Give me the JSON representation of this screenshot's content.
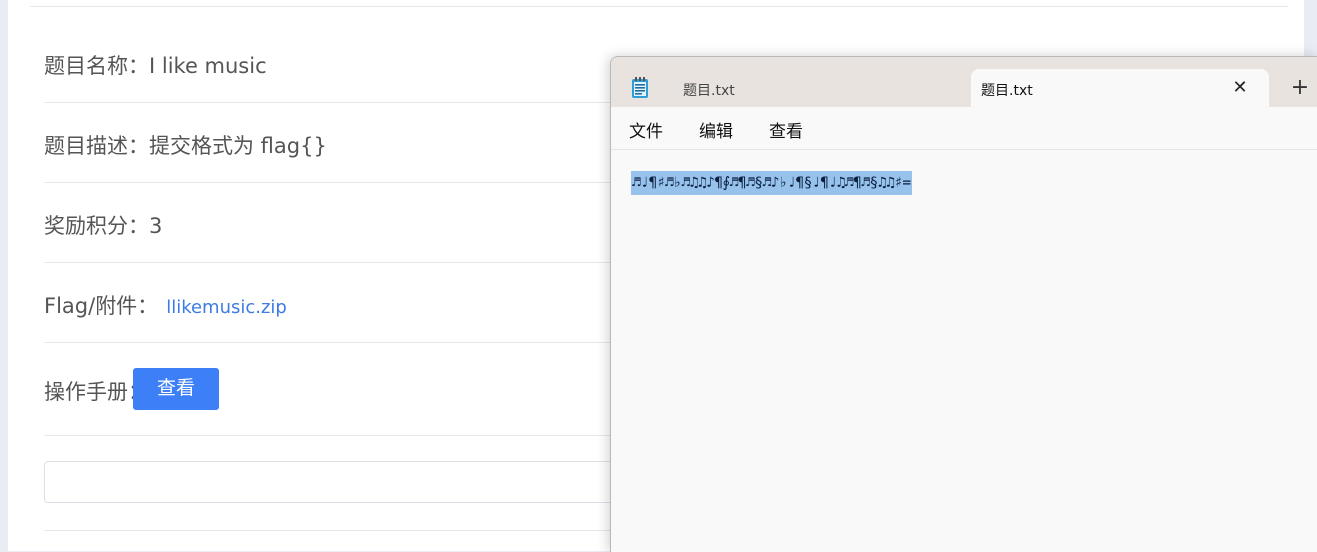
{
  "challenge": {
    "name_label": "题目名称：",
    "name_value": "I like music",
    "desc_label": "题目描述：",
    "desc_value": "提交格式为 flag{}",
    "score_label": "奖励积分：",
    "score_value": "3",
    "attachment_label": "Flag/附件：",
    "attachment_link": "llikemusic.zip",
    "manual_label": "操作手册：",
    "manual_button": "查看",
    "answer_value": ""
  },
  "notepad": {
    "tabs": [
      {
        "label": "题目.txt",
        "active": false
      },
      {
        "label": "题目.txt",
        "active": true
      }
    ],
    "close_glyph": "✕",
    "new_tab_glyph": "+",
    "menu": [
      "文件",
      "编辑",
      "查看"
    ],
    "content": "♬♩¶♯♬♭♬♫♫♪¶∮♬¶♬§♬♪♭♩¶§♩¶♩♫♬¶♬§♫♫♯=",
    "icon": "notepad-icon",
    "selection_color": "#96c2ec"
  }
}
